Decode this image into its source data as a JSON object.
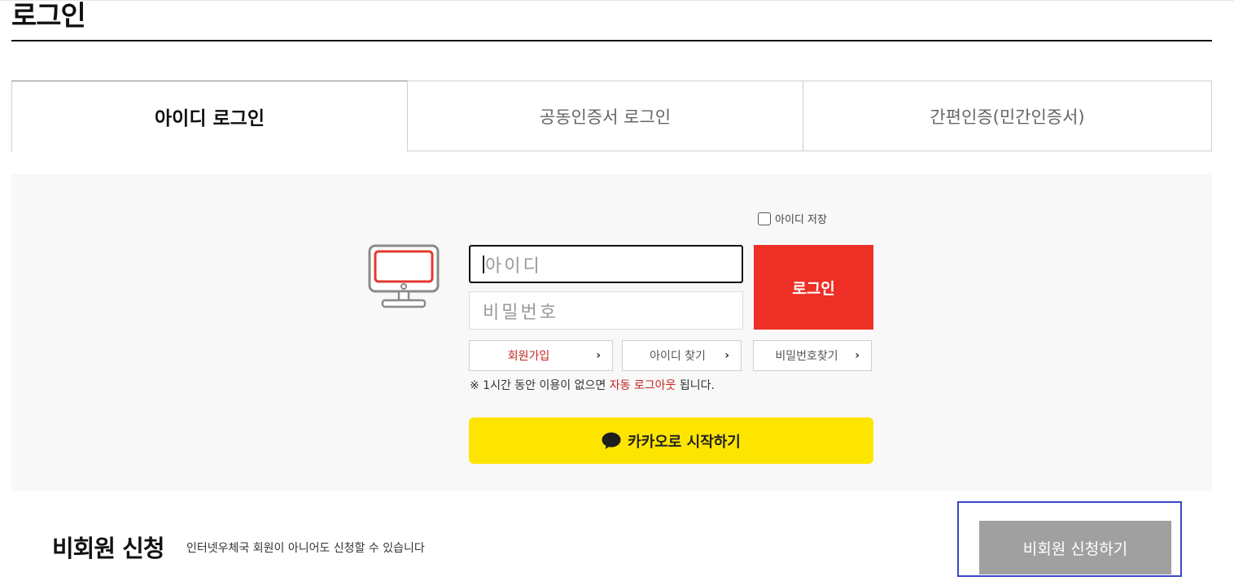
{
  "page": {
    "title": "로그인"
  },
  "tabs": [
    {
      "label": "아이디 로그인",
      "active": true
    },
    {
      "label": "공동인증서 로그인",
      "active": false
    },
    {
      "label": "간편인증(민간인증서)",
      "active": false
    }
  ],
  "login": {
    "save_id_label": "아이디 저장",
    "id_placeholder": "아이디",
    "pw_placeholder": "비밀번호",
    "login_label": "로그인",
    "links": {
      "join": "회원가입",
      "find_id": "아이디 찾기",
      "find_pw": "비밀번호찾기"
    },
    "notice": {
      "prefix": "※ 1시간 동안 이용이 없으면 ",
      "highlight": "자동 로그아웃",
      "suffix": " 됩니다."
    },
    "kakao_label": "카카오로 시작하기"
  },
  "guest": {
    "title": "비회원 신청",
    "description": "인터넷우체국 회원이 아니어도 신청할 수 있습니다",
    "button_label": "비회원 신청하기"
  },
  "colors": {
    "login_red": "#ee2f26",
    "kakao_yellow": "#fee500",
    "link_red": "#c2261f",
    "guest_gray": "#a0a0a0",
    "focus_blue": "#3b47c4"
  }
}
